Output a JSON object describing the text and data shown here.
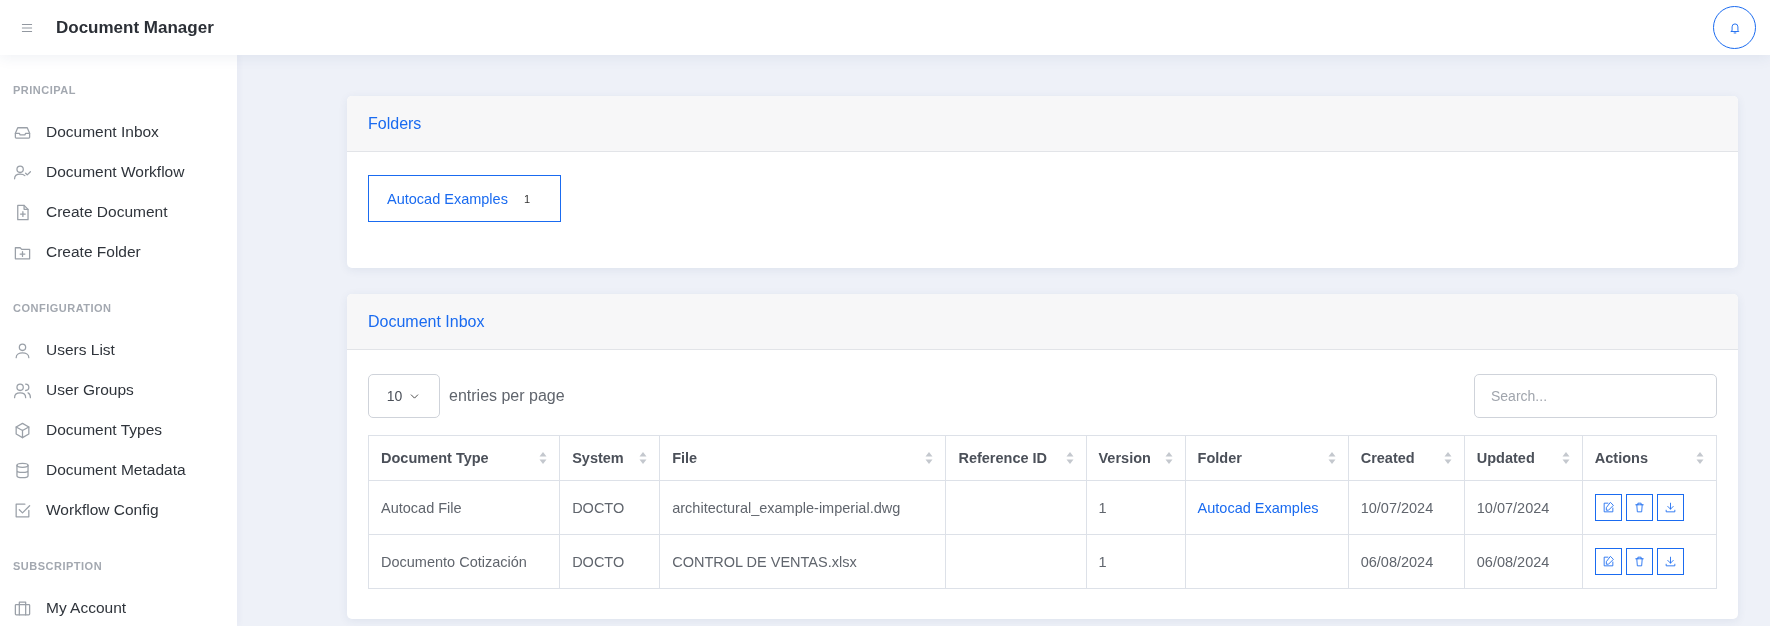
{
  "header": {
    "title": "Document Manager"
  },
  "sidebar": {
    "sections": [
      {
        "label": "PRINCIPAL",
        "items": [
          {
            "label": "Document Inbox"
          },
          {
            "label": "Document Workflow"
          },
          {
            "label": "Create Document"
          },
          {
            "label": "Create Folder"
          }
        ]
      },
      {
        "label": "CONFIGURATION",
        "items": [
          {
            "label": "Users List"
          },
          {
            "label": "User Groups"
          },
          {
            "label": "Document Types"
          },
          {
            "label": "Document Metadata"
          },
          {
            "label": "Workflow Config"
          }
        ]
      },
      {
        "label": "SUBSCRIPTION",
        "items": [
          {
            "label": "My Account"
          }
        ]
      }
    ]
  },
  "folders": {
    "title": "Folders",
    "items": [
      {
        "name": "Autocad Examples",
        "count": "1"
      }
    ]
  },
  "inbox": {
    "title": "Document Inbox",
    "page_size": "10",
    "entries_label": "entries per page",
    "search": {
      "placeholder": "Search..."
    },
    "columns": [
      {
        "label": "Document Type",
        "kind": "text"
      },
      {
        "label": "System",
        "kind": "text"
      },
      {
        "label": "File",
        "kind": "text"
      },
      {
        "label": "Reference ID",
        "kind": "text"
      },
      {
        "label": "Version",
        "kind": "text"
      },
      {
        "label": "Folder",
        "kind": "link"
      },
      {
        "label": "Created",
        "kind": "text"
      },
      {
        "label": "Updated",
        "kind": "text"
      },
      {
        "label": "Actions",
        "kind": "actions"
      }
    ],
    "rows": [
      {
        "cells": [
          "Autocad File",
          "DOCTO",
          "architectural_example-imperial.dwg",
          null,
          "1",
          "Autocad Examples",
          "10/07/2024",
          "10/07/2024",
          null
        ]
      },
      {
        "cells": [
          "Documento Cotización",
          "DOCTO",
          "CONTROL DE VENTAS.xlsx",
          null,
          "1",
          null,
          "06/08/2024",
          "06/08/2024",
          null
        ]
      }
    ]
  }
}
